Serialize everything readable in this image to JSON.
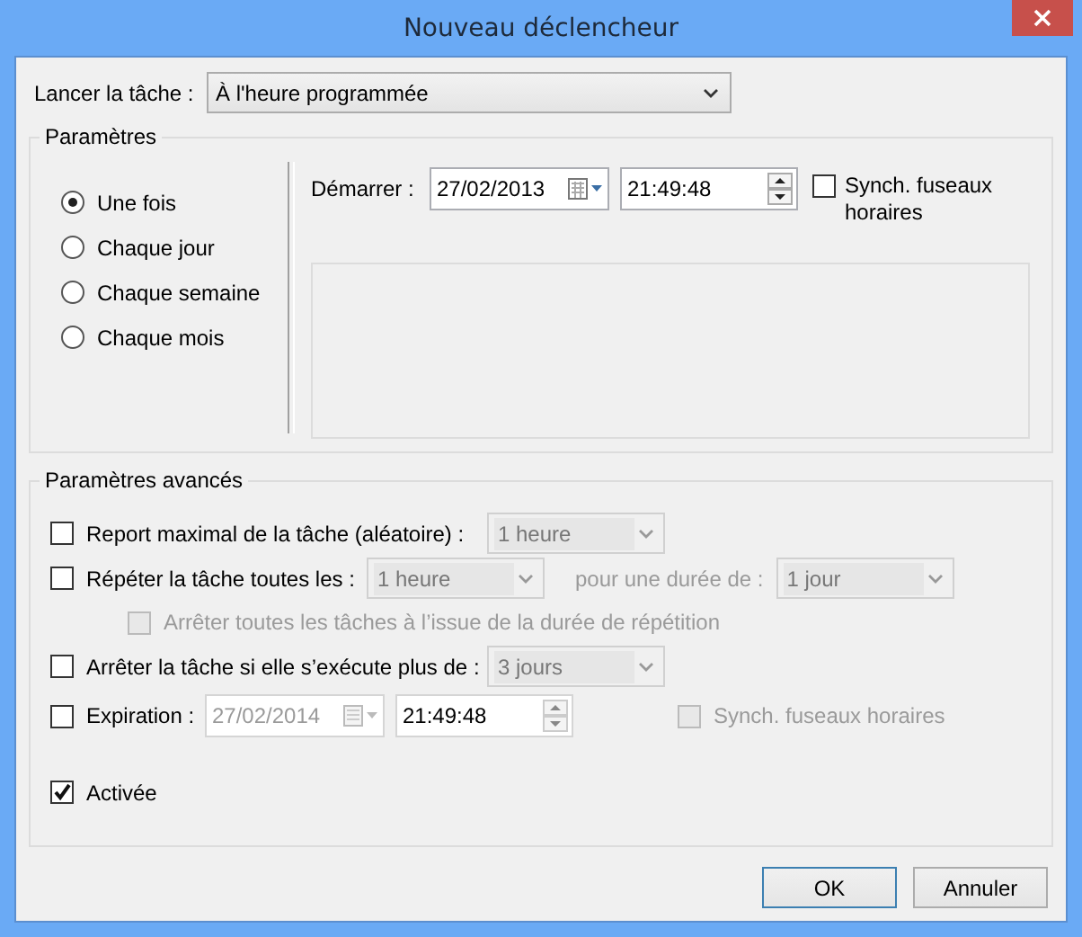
{
  "window": {
    "title": "Nouveau déclencheur"
  },
  "launch": {
    "label": "Lancer la tâche :",
    "value": "À l'heure programmée"
  },
  "settings": {
    "title": "Paramètres",
    "schedules": [
      {
        "label": "Une fois",
        "selected": true
      },
      {
        "label": "Chaque jour",
        "selected": false
      },
      {
        "label": "Chaque semaine",
        "selected": false
      },
      {
        "label": "Chaque mois",
        "selected": false
      }
    ],
    "start": {
      "label": "Démarrer :",
      "date": "27/02/2013",
      "time": "21:49:48",
      "sync": {
        "label": "Synch. fuseaux horaires",
        "checked": false
      }
    }
  },
  "advanced": {
    "title": "Paramètres avancés",
    "rows": [
      {
        "kind": "select",
        "label": "Report maximal de la tâche (aléatoire) :",
        "checked": false,
        "value": "1 heure"
      },
      {
        "kind": "repeat",
        "label": "Répéter la tâche toutes les :",
        "checked": false,
        "value": "1 heure",
        "duration_label": "pour une durée de :",
        "duration": "1 jour"
      },
      {
        "kind": "sub",
        "label": "Arrêter toutes les tâches à l’issue de la durée de répétition",
        "checked": false,
        "disabled": true
      },
      {
        "kind": "select",
        "label": "Arrêter la tâche si elle s’exécute plus de :",
        "checked": false,
        "value": "3 jours"
      },
      {
        "kind": "expiration",
        "label": "Expiration :",
        "checked": false,
        "date": "27/02/2014",
        "time": "21:49:48",
        "sync": {
          "label": "Synch. fuseaux horaires",
          "checked": false,
          "disabled": true
        }
      },
      {
        "kind": "check",
        "label": "Activée",
        "checked": true
      }
    ]
  },
  "buttons": [
    {
      "label": "OK",
      "default": true
    },
    {
      "label": "Annuler",
      "default": false
    }
  ]
}
